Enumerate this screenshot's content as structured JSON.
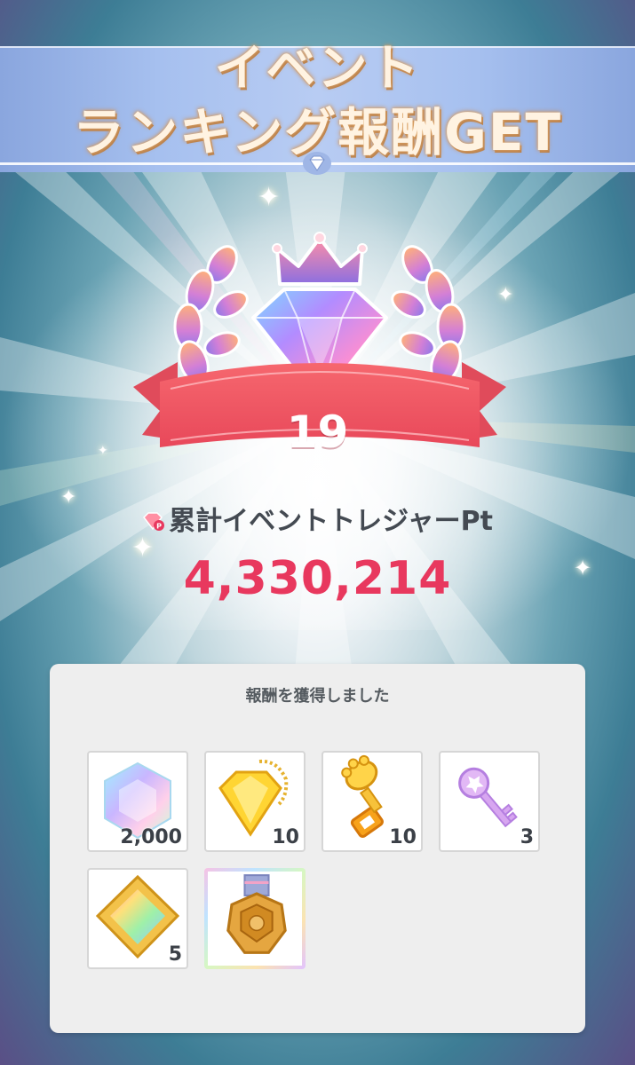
{
  "header": {
    "title_line1": "イベント",
    "title_line2": "ランキング報酬GET"
  },
  "rank": {
    "number": "19"
  },
  "points": {
    "label": "累計イベントトレジャーPt",
    "value": "4,330,214",
    "icon": "treasure-pt-gem-icon"
  },
  "rewards": {
    "title": "報酬を獲得しました",
    "items": [
      {
        "name": "rainbow-crystal-icon",
        "qty": "2,000"
      },
      {
        "name": "gold-gem-charm-icon",
        "qty": "10"
      },
      {
        "name": "gold-glove-key-icon",
        "qty": "10"
      },
      {
        "name": "purple-key-icon",
        "qty": "3"
      },
      {
        "name": "rainbow-square-gem-icon",
        "qty": "5"
      },
      {
        "name": "gold-medal-icon",
        "qty": ""
      }
    ]
  },
  "colors": {
    "accent_pink": "#e8385e",
    "ribbon": "#ef5a66",
    "banner_blue": "#a6c0ef"
  }
}
